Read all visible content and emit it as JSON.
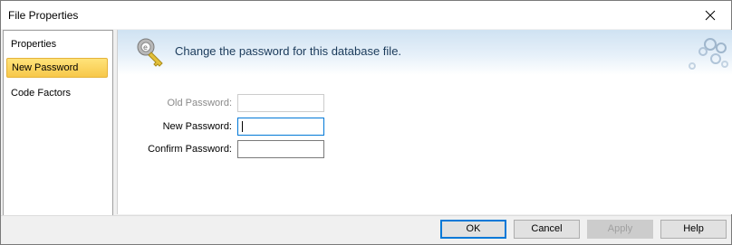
{
  "window": {
    "title": "File Properties"
  },
  "sidebar": {
    "items": [
      {
        "label": "Properties",
        "selected": false
      },
      {
        "label": "New Password",
        "selected": true
      },
      {
        "label": "Code Factors",
        "selected": false
      }
    ]
  },
  "banner": {
    "text": "Change the password for this database file."
  },
  "form": {
    "old_password": {
      "label": "Old Password:",
      "value": "",
      "enabled": false
    },
    "new_password": {
      "label": "New Password:",
      "value": "",
      "focused": true
    },
    "confirm_password": {
      "label": "Confirm Password:",
      "value": ""
    }
  },
  "buttons": {
    "ok": "OK",
    "cancel": "Cancel",
    "apply": "Apply",
    "help": "Help"
  },
  "colors": {
    "selected_item": "#f7c84a",
    "focus_border": "#0078d7",
    "banner": "#cfe2f2"
  }
}
